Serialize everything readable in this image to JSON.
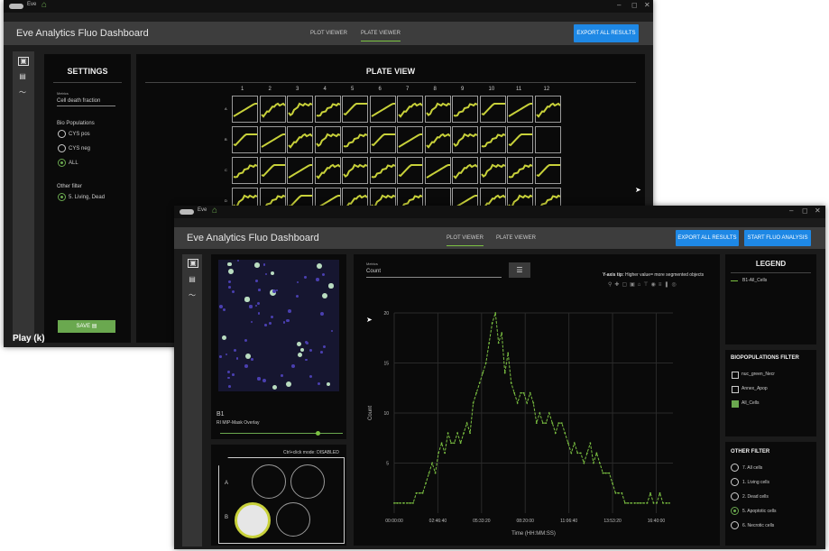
{
  "back_window": {
    "app_name": "Eve",
    "title": "Eve Analytics Fluo Dashboard",
    "tabs": [
      {
        "label": "PLOT VIEWER"
      },
      {
        "label": "PLATE VIEWER"
      }
    ],
    "export_button": "EXPORT ALL RESULTS",
    "settings": {
      "title": "SETTINGS",
      "metrics_label": "Metrics",
      "metrics_value": "Cell death fraction",
      "bio_label": "Bio Populations",
      "bio_options": [
        "CYS pos",
        "CYS neg",
        "ALL"
      ],
      "bio_selected": 2,
      "other_label": "Other filter",
      "other_options": [
        "5. Living, Dead"
      ],
      "save_label": "SAVE"
    },
    "plate": {
      "title": "PLATE VIEW",
      "columns": [
        "1",
        "2",
        "3",
        "4",
        "5",
        "6",
        "7",
        "8",
        "9",
        "10",
        "11",
        "12"
      ],
      "rows": [
        "A",
        "B",
        "C",
        "D"
      ]
    },
    "play_tooltip": "Play (k)"
  },
  "front_window": {
    "app_name": "Eve",
    "title": "Eve Analytics Fluo Dashboard",
    "tabs": [
      {
        "label": "PLOT VIEWER"
      },
      {
        "label": "PLATE VIEWER"
      }
    ],
    "export_button": "EXPORT ALL RESULTS",
    "start_button": "START FLUO ANALYSIS",
    "image_panel": {
      "well": "B1",
      "overlay": "RI MIP-Mask Overlay"
    },
    "well_panel": {
      "mode": "Ctrl+click mode: DISABLED",
      "rows": [
        "A",
        "B"
      ]
    },
    "plot": {
      "metrics_label": "Metrics",
      "metrics_value": "Count",
      "tip_bold": "Y-axis tip:",
      "tip_text": " Higher value= more segmented objects"
    },
    "legend": {
      "title": "LEGEND",
      "entry": "B1-All_Cells"
    },
    "bio_filter": {
      "title": "BIOPOPULATIONS FILTER",
      "items": [
        {
          "label": "nuc_green_Necr",
          "checked": false
        },
        {
          "label": "Annex_Apop",
          "checked": false
        },
        {
          "label": "All_Cells",
          "checked": true
        }
      ]
    },
    "other_filter": {
      "title": "OTHER FILTER",
      "options": [
        "7. All cells",
        "1. Living cells",
        "2. Dead cells",
        "5. Apoptotic cells",
        "6. Necrotic cells"
      ],
      "selected": 3
    }
  },
  "chart_data": {
    "type": "line",
    "xlabel": "Time (HH:MM:SS)",
    "ylabel": "Count",
    "x_ticks": [
      "00:00:00",
      "02:46:40",
      "05:33:20",
      "08:20:00",
      "11:06:40",
      "13:53:20",
      "16:40:00"
    ],
    "y_ticks": [
      5,
      10,
      15,
      20
    ],
    "ylim": [
      0,
      20
    ],
    "series": [
      {
        "name": "B1-All_Cells",
        "color": "#7cc242",
        "values": [
          1,
          1,
          1,
          1,
          1,
          1,
          1,
          2,
          2,
          2,
          3,
          4,
          5,
          4,
          6,
          7,
          6,
          8,
          7,
          7,
          8,
          7,
          8,
          9,
          8,
          11,
          12,
          13,
          14,
          15,
          17,
          19,
          20,
          17,
          18,
          14,
          16,
          13,
          12,
          11,
          12,
          12,
          11,
          12,
          11,
          9,
          10,
          9,
          9,
          10,
          9,
          8,
          9,
          9,
          8,
          7,
          6,
          7,
          6,
          6,
          5,
          6,
          7,
          5,
          6,
          5,
          4,
          4,
          4,
          3,
          2,
          2,
          2,
          1,
          1,
          1,
          1,
          1,
          1,
          1,
          1,
          2,
          1,
          1,
          2,
          1,
          1,
          1
        ]
      }
    ]
  },
  "colors": {
    "accent": "#7cc242",
    "button": "#1e88e5",
    "trace": "#c8d13a"
  }
}
